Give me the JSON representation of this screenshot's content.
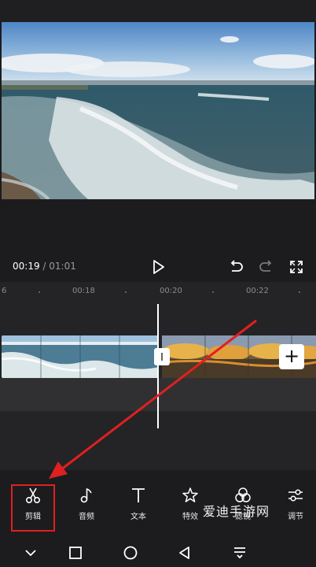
{
  "playback": {
    "current_time": "00:19",
    "separator": " / ",
    "total_duration": "01:01"
  },
  "ruler": {
    "ticks": [
      "6",
      "00:18",
      "00:20",
      "00:22"
    ]
  },
  "timeline": {
    "add_label": "+"
  },
  "toolbar": {
    "items": [
      {
        "label": "剪辑",
        "icon": "scissors-icon"
      },
      {
        "label": "音频",
        "icon": "music-note-icon"
      },
      {
        "label": "文本",
        "icon": "text-icon"
      },
      {
        "label": "特效",
        "icon": "sparkle-star-icon"
      },
      {
        "label": "滤镜",
        "icon": "filter-circles-icon"
      },
      {
        "label": "调节",
        "icon": "adjust-sliders-icon"
      }
    ],
    "highlight_color": "#e02020"
  },
  "watermark": "爱迪手游网",
  "nav": [
    "chevron-down-icon",
    "square-recents-icon",
    "circle-home-icon",
    "triangle-back-icon",
    "menu-lines-icon"
  ],
  "colors": {
    "background": "#1c1c1e",
    "timeline_bg": "#242426",
    "arrow": "#e02020"
  }
}
